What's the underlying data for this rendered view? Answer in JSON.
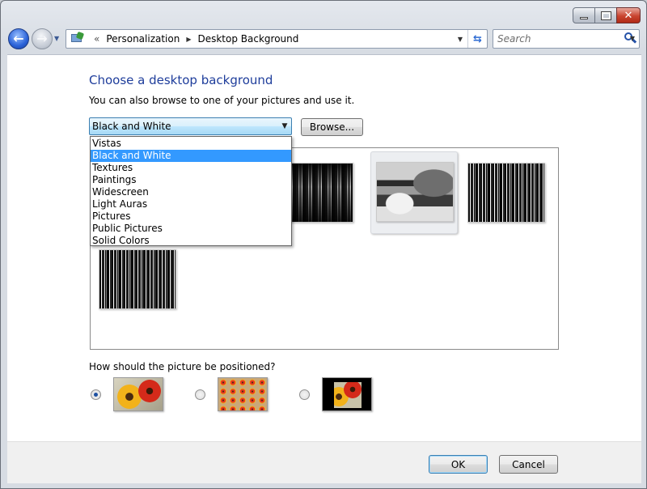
{
  "nav": {
    "breadcrumb_sep": "«",
    "crumbs": [
      "Personalization",
      "Desktop Background"
    ],
    "search_placeholder": "Search"
  },
  "main": {
    "heading": "Choose a desktop background",
    "subtext": "You can also browse to one of your pictures and use it.",
    "location_select": {
      "value": "Black and White",
      "options": [
        "Vistas",
        "Black and White",
        "Textures",
        "Paintings",
        "Widescreen",
        "Light Auras",
        "Pictures",
        "Public Pictures",
        "Solid Colors"
      ]
    },
    "browse_label": "Browse...",
    "position_question": "How should the picture be positioned?",
    "position_options": [
      "fit-to-screen",
      "tile",
      "center"
    ],
    "position_selected": "fit-to-screen"
  },
  "footer": {
    "ok_label": "OK",
    "cancel_label": "Cancel"
  },
  "colors": {
    "heading": "#1e3d9b",
    "selection": "#3399ff"
  }
}
